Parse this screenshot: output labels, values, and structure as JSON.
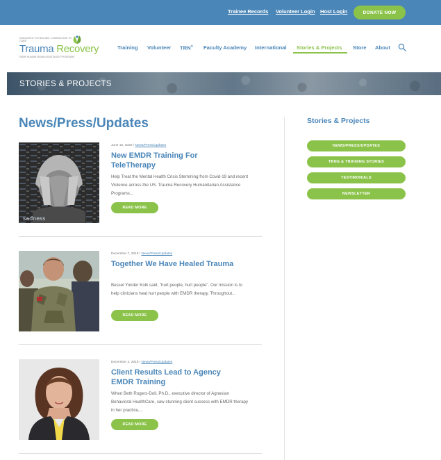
{
  "topbar": {
    "links": [
      "Trainee Records",
      "Volunteer Login",
      "Host Login"
    ],
    "donate_label": "DONATE NOW"
  },
  "logo": {
    "small_text": "Dedicated to Healing, Compassion to Care",
    "name_part1": "Trauma",
    "name_part2": "Recovery",
    "tagline": "EMDR Humanitarian Assistance Programs"
  },
  "nav": {
    "items": [
      "Training",
      "Volunteer",
      "TRN",
      "Faculty Academy",
      "International",
      "Stories & Projects",
      "Store",
      "About"
    ],
    "trn_sup": "®",
    "active": "Stories & Projects"
  },
  "banner": {
    "title": "STORIES & PROJECTS"
  },
  "main": {
    "title": "News/Press/Updates",
    "read_more": "READ MORE",
    "posts": [
      {
        "date": "June 16, 2020",
        "sep": " / ",
        "category": "News/Press/Updates",
        "title": "New EMDR Training For TeleTherapy",
        "excerpt": "Help Treat the Mental Health Crisis Stemming from Covid-19 and recent Violence across the US. Trauma Recovery Humanitarian Assistance Programs...",
        "thumb_word": "sadness"
      },
      {
        "date": "December 7, 2019",
        "sep": " / ",
        "category": "News/Press/Updates",
        "title": "Together We Have Healed Trauma",
        "excerpt": "Bessel Yonder Kolk said, \"hurt people, hurt people\". Our mission is to help clinicians heal hurt people with EMDR therapy. Throughout..."
      },
      {
        "date": "December 4, 2019",
        "sep": " / ",
        "category": "News/Press/Updates",
        "title": "Client Results Lead to Agency EMDR Training",
        "excerpt": "When Beth Rogers-Doll, Ph.D., executive director of Agnesian Behavioral HealthCare, saw stunning client success with EMDR therapy in her practice,..."
      }
    ]
  },
  "sidebar": {
    "title": "Stories & Projects",
    "buttons": [
      "NEWS/PRESS/UPDATES",
      "TRNG & TRAINING STORIES",
      "TESTIMONIALS",
      "NEWSLETTER"
    ]
  },
  "colors": {
    "brand_blue": "#4a86b8",
    "brand_green": "#8bc34a"
  }
}
